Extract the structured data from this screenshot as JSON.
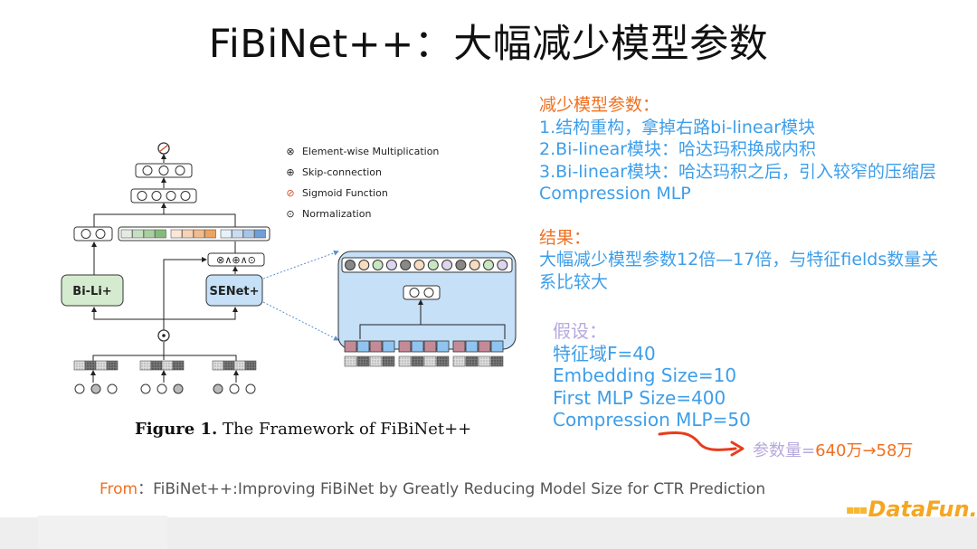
{
  "slide": {
    "title": "FiBiNet++：大幅减少模型参数",
    "notes": {
      "heading": "减少模型参数：",
      "items": [
        "1.结构重构，拿掉右路bi-linear模块",
        "2.Bi-linear模块：哈达玛积换成内积",
        "3.Bi-linear模块：哈达玛积之后，引入较窄的压缩层",
        "Compression MLP"
      ],
      "result_heading": "结果：",
      "result_lines": [
        "大幅减少模型参数12倍—17倍，与特征fields数量关",
        "系比较大"
      ]
    },
    "assumptions": {
      "heading": "假设：",
      "items": [
        "特征域F=40",
        "Embedding Size=10",
        "First MLP Size=400",
        "Compression MLP=50"
      ]
    },
    "param_result": {
      "label": "参数量=",
      "value": "640万→58万"
    },
    "figure": {
      "caption_bold": "Figure 1.",
      "caption_text": " The Framework of FiBiNet++",
      "legend": [
        {
          "icon": "element-wise-multiplication-icon",
          "symbol": "⊗",
          "label": "Element-wise Multiplication"
        },
        {
          "icon": "skip-connection-icon",
          "symbol": "⊕",
          "label": "Skip-connection"
        },
        {
          "icon": "sigmoid-function-icon",
          "symbol": "⊘",
          "label": "Sigmoid Function"
        },
        {
          "icon": "normalization-icon",
          "symbol": "⊙",
          "label": "Normalization"
        }
      ],
      "blocks": {
        "bilinear": "Bi-Li+",
        "senet": "SENet+",
        "ops": "⊗∧⊕∧⊙"
      },
      "colors": {
        "bilinear_fill": "#d5ebcf",
        "senet_fill": "#c5e0f7",
        "green": [
          "#e4ece2",
          "#c6dfc0",
          "#a9cfa0",
          "#86ba7c"
        ],
        "orange": [
          "#fbe7d6",
          "#f7d3b3",
          "#f3bb8a",
          "#eda45f"
        ],
        "blue": [
          "#e7f1fb",
          "#c9dcf1",
          "#a8c5e9",
          "#6f9fd9"
        ]
      }
    },
    "source": {
      "from_label": "From",
      "text": "：FiBiNet++:Improving FiBiNet by Greatly Reducing Model Size for CTR Prediction"
    },
    "logo": "DataFun."
  }
}
